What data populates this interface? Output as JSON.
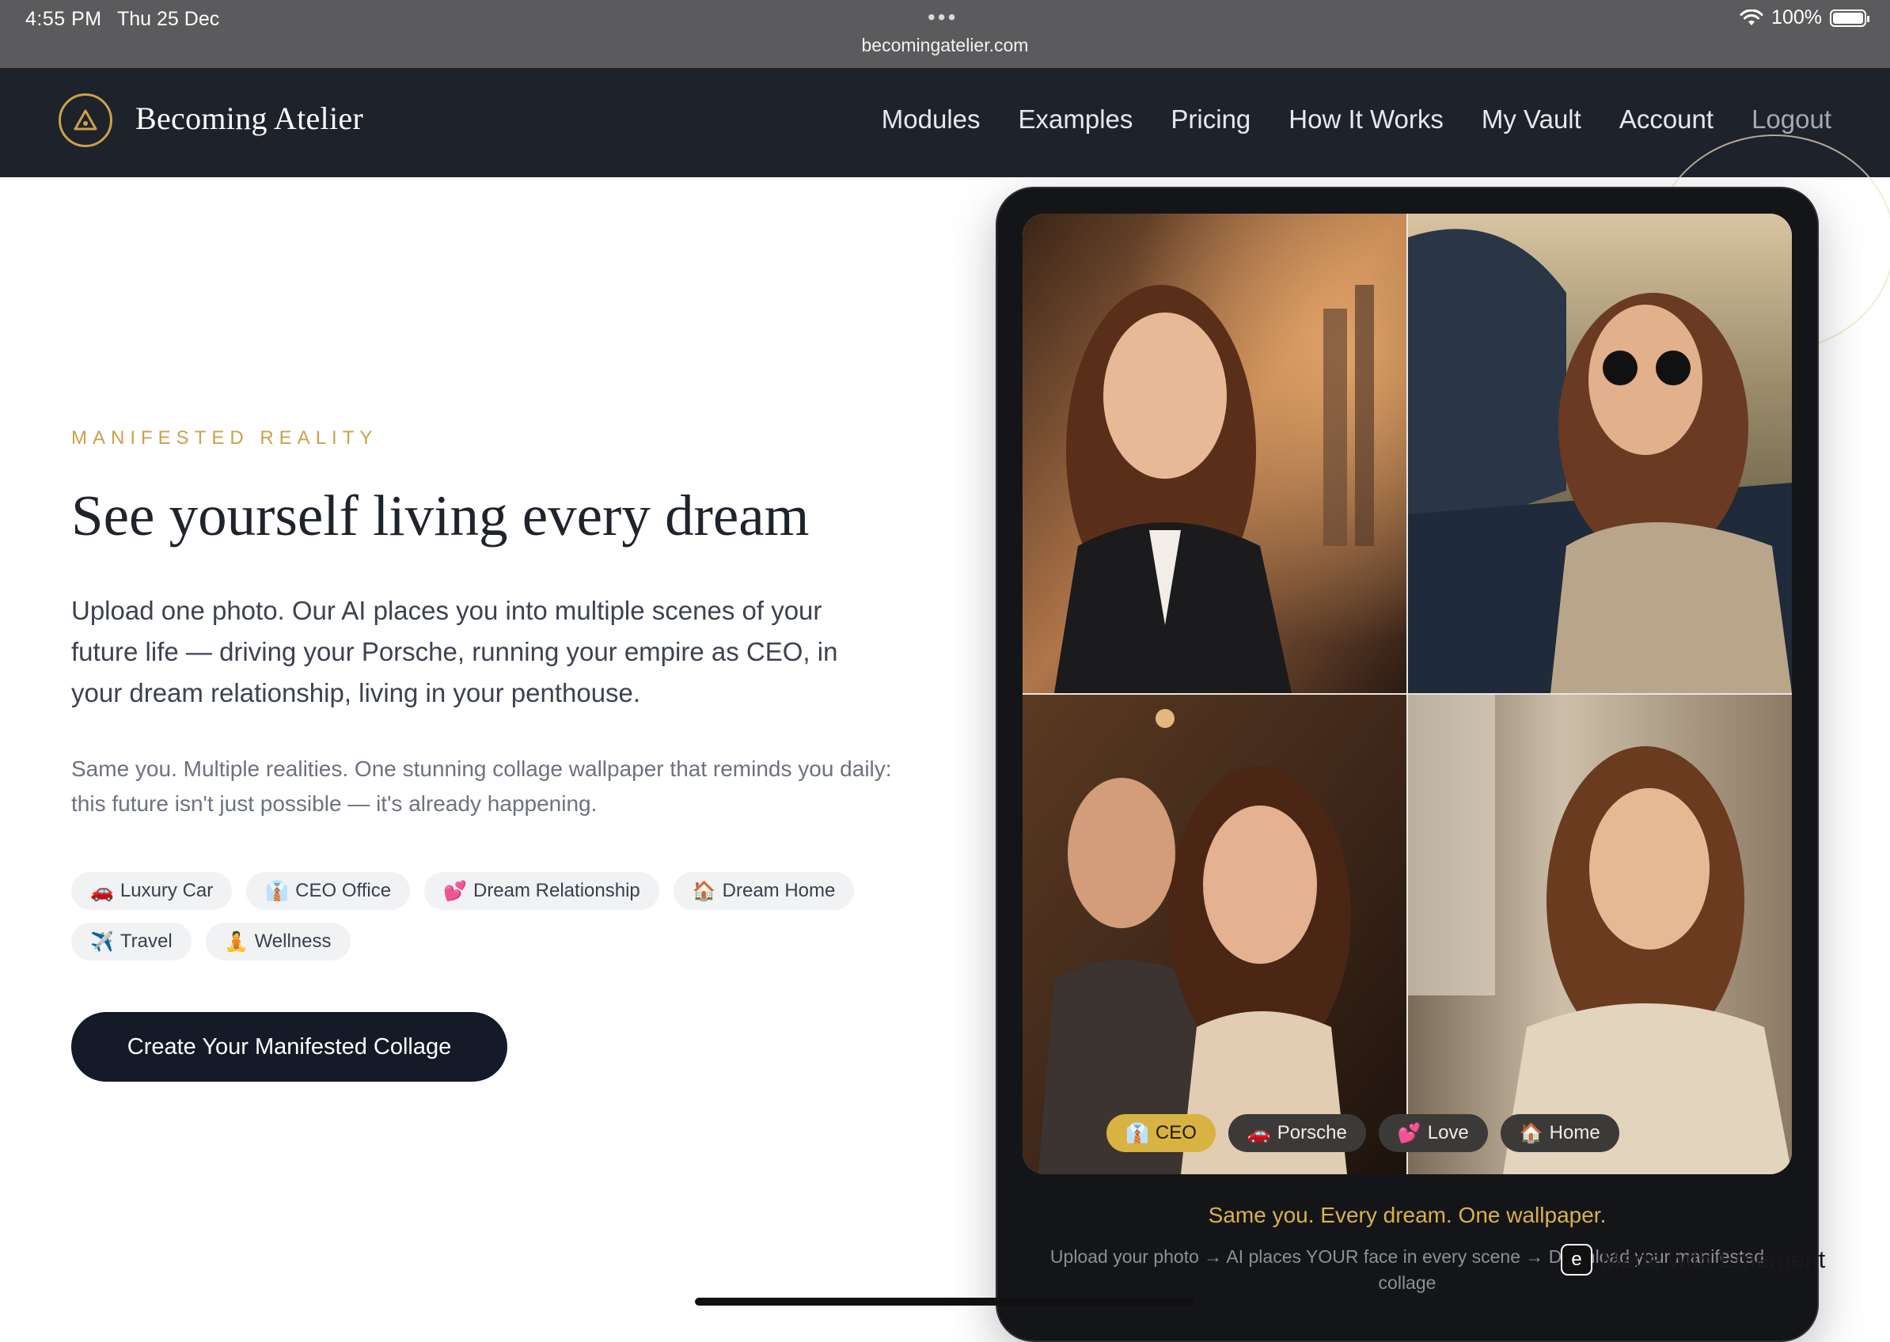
{
  "status_bar": {
    "time": "4:55 PM",
    "date": "Thu 25 Dec",
    "url": "becomingatelier.com",
    "battery": "100%"
  },
  "nav": {
    "brand": "Becoming Atelier",
    "links": [
      "Modules",
      "Examples",
      "Pricing",
      "How It Works",
      "My Vault",
      "Account",
      "Logout"
    ]
  },
  "hero": {
    "eyebrow": "MANIFESTED REALITY",
    "headline": "See yourself living every dream",
    "lead": "Upload one photo. Our AI places you into multiple scenes of your future life — driving your Porsche, running your empire as CEO, in your dream relationship, living in your penthouse.",
    "sub": "Same you. Multiple realities. One stunning collage wallpaper that reminds you daily: this future isn't just possible — it's already happening.",
    "chips": [
      {
        "icon": "🚗",
        "label": "Luxury Car"
      },
      {
        "icon": "👔",
        "label": "CEO Office"
      },
      {
        "icon": "💕",
        "label": "Dream Relationship"
      },
      {
        "icon": "🏠",
        "label": "Dream Home"
      },
      {
        "icon": "✈️",
        "label": "Travel"
      },
      {
        "icon": "🧘",
        "label": "Wellness"
      }
    ],
    "cta": "Create Your Manifested Collage"
  },
  "device": {
    "tags": [
      {
        "icon": "👔",
        "label": "CEO",
        "active": true
      },
      {
        "icon": "🚗",
        "label": "Porsche",
        "active": false
      },
      {
        "icon": "💕",
        "label": "Love",
        "active": false
      },
      {
        "icon": "🏠",
        "label": "Home",
        "active": false
      }
    ],
    "title": "Same you. Every dream. One wallpaper.",
    "subtitle": "Upload your photo → AI places YOUR face in every scene → Download your manifested collage"
  },
  "badge": {
    "label": "Made with Emergent",
    "icon": "e"
  },
  "colors": {
    "accent_gold": "#c9a24a",
    "nav_bg": "#1e222b",
    "cta_bg": "#141a27"
  }
}
